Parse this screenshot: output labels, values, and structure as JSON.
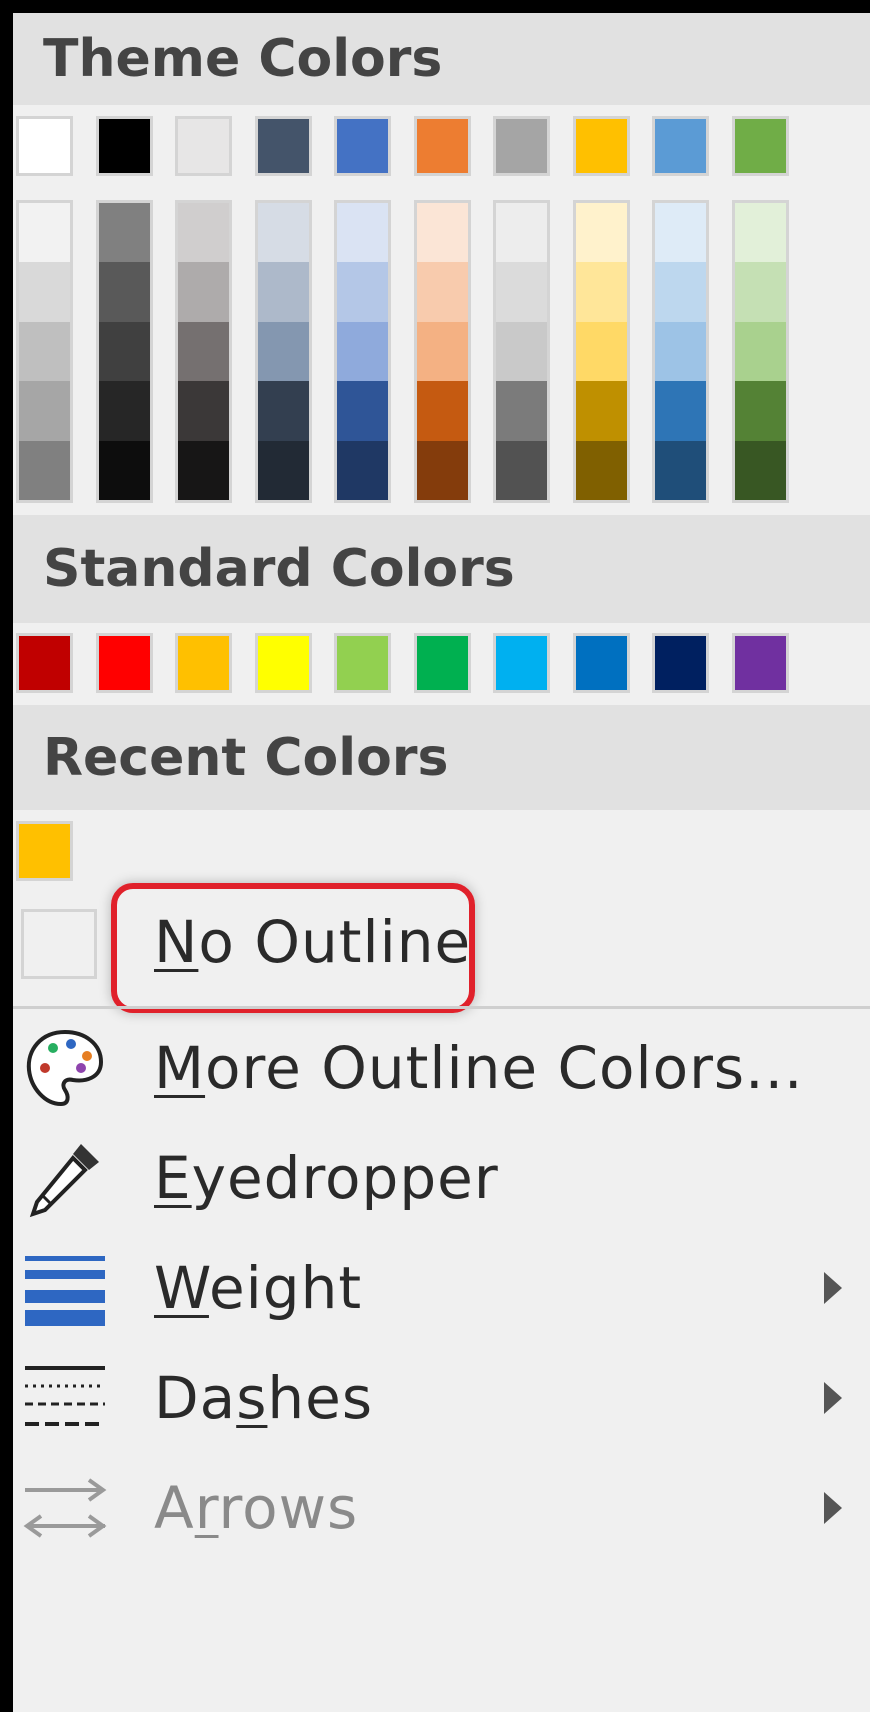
{
  "sections": {
    "theme_title": "Theme Colors",
    "standard_title": "Standard Colors",
    "recent_title": "Recent Colors"
  },
  "theme": {
    "top": [
      "#ffffff",
      "#000000",
      "#e7e6e6",
      "#44546a",
      "#4472c4",
      "#ed7d31",
      "#a5a5a5",
      "#ffc000",
      "#5b9bd5",
      "#70ad47"
    ],
    "shades": [
      [
        "#f2f2f2",
        "#d9d9d9",
        "#bfbfbf",
        "#a6a6a6",
        "#808080"
      ],
      [
        "#808080",
        "#595959",
        "#404040",
        "#262626",
        "#0d0d0d"
      ],
      [
        "#d0cece",
        "#aeabab",
        "#757070",
        "#3b3838",
        "#171616"
      ],
      [
        "#d6dce5",
        "#adb9ca",
        "#8497b0",
        "#333f50",
        "#222a35"
      ],
      [
        "#dae3f3",
        "#b4c7e7",
        "#8faadc",
        "#2f5597",
        "#1f3864"
      ],
      [
        "#fbe5d6",
        "#f8cbad",
        "#f4b183",
        "#c55a11",
        "#843c0c"
      ],
      [
        "#ededed",
        "#dbdbdb",
        "#c9c9c9",
        "#7b7b7b",
        "#525252"
      ],
      [
        "#fff2cc",
        "#ffe699",
        "#ffd966",
        "#bf9000",
        "#806000"
      ],
      [
        "#deebf7",
        "#bdd7ee",
        "#9dc3e6",
        "#2e75b6",
        "#1f4e79"
      ],
      [
        "#e2f0d9",
        "#c5e0b4",
        "#a9d18e",
        "#548235",
        "#385723"
      ]
    ]
  },
  "standard": [
    "#c00000",
    "#ff0000",
    "#ffc000",
    "#ffff00",
    "#92d050",
    "#00b050",
    "#00b0f0",
    "#0070c0",
    "#002060",
    "#7030a0"
  ],
  "recent": [
    "#ffc000"
  ],
  "items": {
    "no_outline": {
      "u": "N",
      "rest": "o Outline"
    },
    "more": {
      "u": "M",
      "rest": "ore Outline Colors..."
    },
    "eyedropper": {
      "u": "E",
      "rest": "yedropper"
    },
    "weight": {
      "u": "W",
      "rest": "eight"
    },
    "dashes": {
      "a": "Da",
      "u": "s",
      "rest": "hes"
    },
    "arrows": {
      "a": "A",
      "u": "r",
      "rest": "rows"
    }
  },
  "icons": {
    "palette": "palette-icon",
    "eyedropper": "eyedropper-icon",
    "weight": "line-weight-icon",
    "dashes": "dashes-icon",
    "arrows": "arrows-icon",
    "submenu": "submenu-arrow-icon"
  },
  "accent": {
    "highlight": "#e0212b",
    "weight_blue": "#2e67c2"
  }
}
